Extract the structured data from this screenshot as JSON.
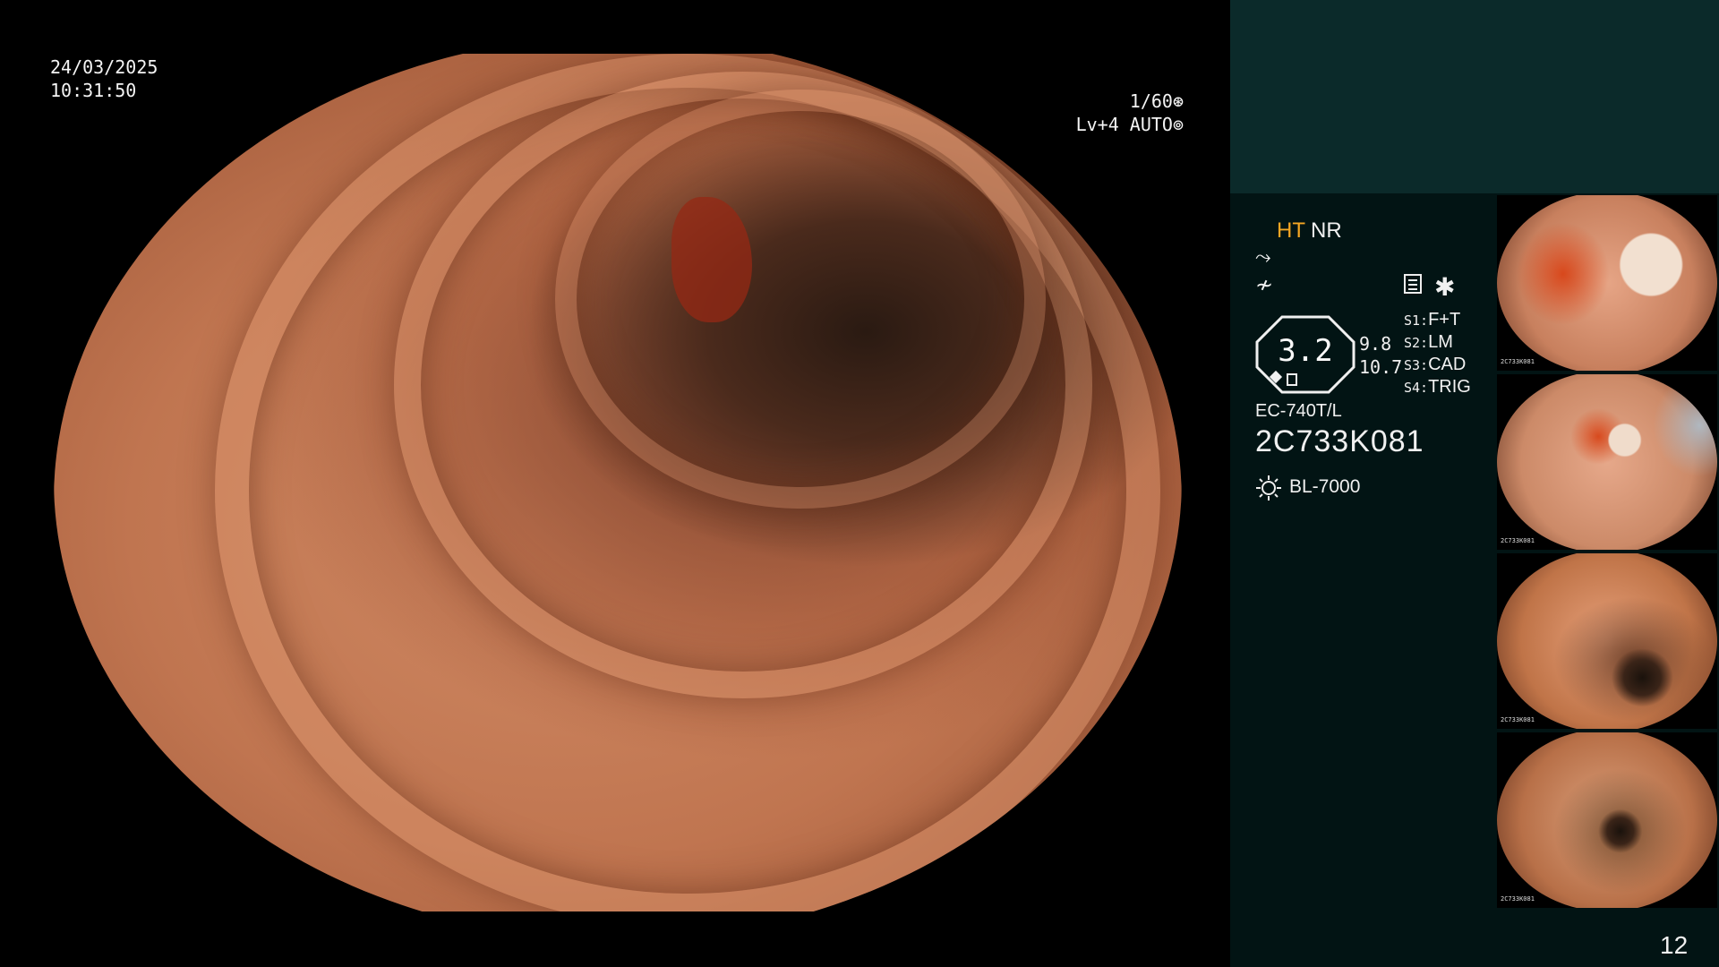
{
  "overlay": {
    "date": "24/03/2025",
    "time": "10:31:50",
    "shutter": "1/60",
    "level": "Lv+4 AUTO"
  },
  "panel": {
    "mode_ht": "HT",
    "mode_nr": "NR",
    "gauge_value": "3.2",
    "value_a": "9.8",
    "value_b": "10.7",
    "switches": [
      {
        "key": "S1:",
        "value": "F+T"
      },
      {
        "key": "S2:",
        "value": "LM"
      },
      {
        "key": "S3:",
        "value": "CAD"
      },
      {
        "key": "S4:",
        "value": "TRIG"
      }
    ],
    "scope_model": "EC-740T/L",
    "scope_serial": "2C733K081",
    "light_source": "BL-7000",
    "page_number": "12"
  },
  "thumbnails": [
    {
      "serial": "2C733K081"
    },
    {
      "serial": "2C733K081"
    },
    {
      "serial": "2C733K081"
    },
    {
      "serial": "2C733K081"
    }
  ],
  "icons": {
    "shutter": "shutter-icon",
    "auto": "auto-exposure-icon",
    "enhance": "enhancement-icon",
    "structure": "structure-icon",
    "menu": "menu-icon",
    "star": "asterisk-icon",
    "light": "light-source-icon"
  }
}
